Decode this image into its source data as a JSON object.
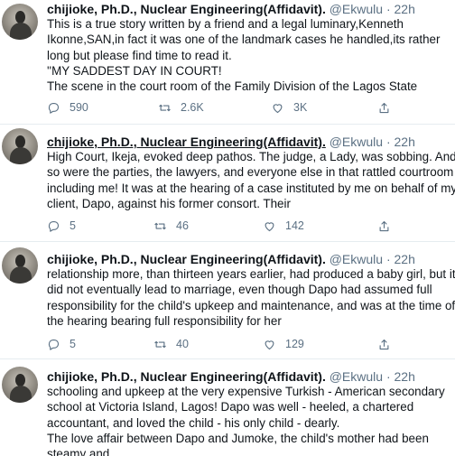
{
  "tweets": [
    {
      "name": "chijioke, Ph.D., Nuclear Engineering(Affidavit).",
      "handle": "@Ekwulu",
      "dot": "·",
      "time": "22h",
      "text": "This is a true story  written by a friend and a legal luminary,Kenneth Ikonne,SAN,in fact it was one of the landmark cases he handled,its rather long but please find time to read it.\n''MY SADDEST DAY IN COURT!\nThe scene in the court room of the Family Division of the Lagos State",
      "replies": "590",
      "retweets": "2.6K",
      "likes": "3K"
    },
    {
      "name": "chijioke, Ph.D., Nuclear Engineering(Affidavit).",
      "handle": "@Ekwulu",
      "dot": "·",
      "time": "22h",
      "text": "High Court, Ikeja, evoked deep pathos. The judge, a Lady, was sobbing. And so were the parties, the lawyers, and everyone else in that rattled courtroom including me! It was at the hearing of a case instituted by me on behalf of my client, Dapo, against his former consort. Their",
      "replies": "5",
      "retweets": "46",
      "likes": "142"
    },
    {
      "name": "chijioke, Ph.D., Nuclear Engineering(Affidavit).",
      "handle": "@Ekwulu",
      "dot": "·",
      "time": "22h",
      "text": "relationship more, than thirteen years earlier, had produced a baby girl, but it did not eventually lead to marriage, even though Dapo had assumed full responsibility for the child's upkeep and maintenance, and was at the time of the hearing bearing full responsibility for her",
      "replies": "5",
      "retweets": "40",
      "likes": "129"
    },
    {
      "name": "chijioke, Ph.D., Nuclear Engineering(Affidavit).",
      "handle": "@Ekwulu",
      "dot": "·",
      "time": "22h",
      "text": "schooling and upkeep at the very expensive Turkish - American secondary school at Victoria Island, Lagos! Dapo was well - heeled, a chartered accountant, and loved the child - his only child - dearly.\nThe love affair between Dapo and Jumoke, the child's mother had been steamy and"
    }
  ],
  "icons": {
    "reply": "reply-icon",
    "retweet": "retweet-icon",
    "like": "like-icon",
    "share": "share-icon"
  },
  "colors": {
    "text": "#0f1419",
    "muted": "#5b7083",
    "divider": "#e6ecf0"
  }
}
